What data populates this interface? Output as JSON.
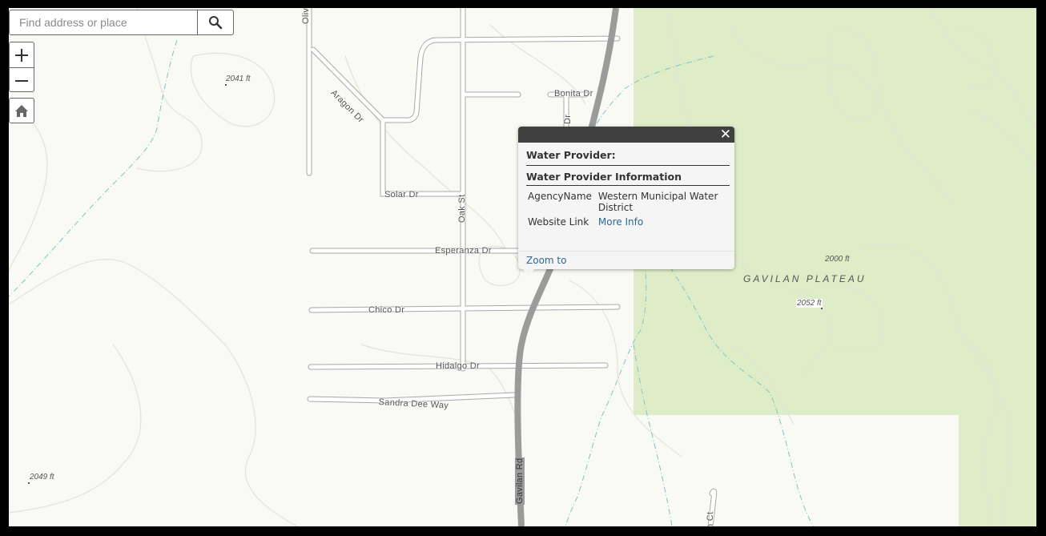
{
  "search": {
    "placeholder": "Find address or place",
    "value": "",
    "button_icon": "search-icon"
  },
  "controls": {
    "zoom_in_icon": "plus-icon",
    "zoom_out_icon": "minus-icon",
    "home_icon": "home-icon"
  },
  "map": {
    "colors": {
      "background": "#f9f9f6",
      "park": "#deedc7",
      "highway": "#9b9b9b",
      "stream": "#7fc4c4",
      "contour": "#e4e4dc"
    },
    "road_labels": [
      "Olive St",
      "Aragon Dr",
      "Bonita Dr",
      "Dr",
      "Solar Dr",
      "Oak St",
      "Esperanza Dr",
      "Chico Dr",
      "Hidalgo Dr",
      "Sandra Dee Way",
      "Gavilan Rd",
      "n Ct"
    ],
    "elevation_labels": [
      "2041 ft",
      "2000 ft",
      "2052 ft",
      "2049 ft"
    ],
    "area_labels": [
      "GAVILAN PLATEAU"
    ]
  },
  "popup": {
    "close_icon": "close-icon",
    "close_label": "✕",
    "title": "Water Provider:",
    "section_title": "Water Provider Information",
    "fields": [
      {
        "key": "AgencyName",
        "value": "Western Municipal Water District"
      },
      {
        "key": "Website Link",
        "value": "More Info"
      }
    ],
    "zoom_to_label": "Zoom to"
  }
}
